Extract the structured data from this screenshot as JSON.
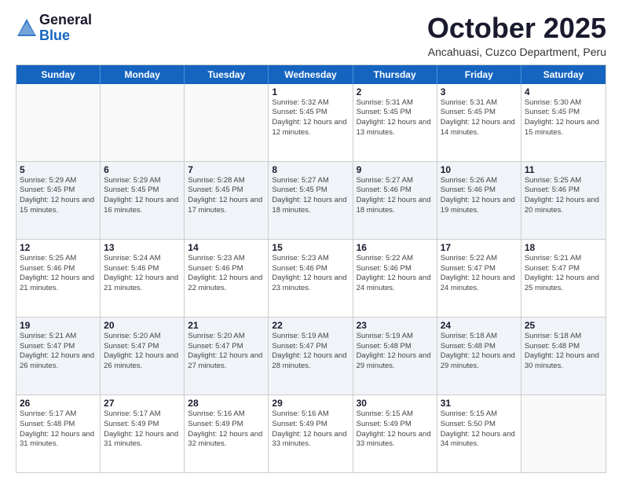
{
  "header": {
    "logo_general": "General",
    "logo_blue": "Blue",
    "month": "October 2025",
    "location": "Ancahuasi, Cuzco Department, Peru"
  },
  "weekdays": [
    "Sunday",
    "Monday",
    "Tuesday",
    "Wednesday",
    "Thursday",
    "Friday",
    "Saturday"
  ],
  "rows": [
    [
      {
        "day": "",
        "sunrise": "",
        "sunset": "",
        "daylight": "",
        "alt": false
      },
      {
        "day": "",
        "sunrise": "",
        "sunset": "",
        "daylight": "",
        "alt": false
      },
      {
        "day": "",
        "sunrise": "",
        "sunset": "",
        "daylight": "",
        "alt": false
      },
      {
        "day": "1",
        "sunrise": "Sunrise: 5:32 AM",
        "sunset": "Sunset: 5:45 PM",
        "daylight": "Daylight: 12 hours and 12 minutes.",
        "alt": false
      },
      {
        "day": "2",
        "sunrise": "Sunrise: 5:31 AM",
        "sunset": "Sunset: 5:45 PM",
        "daylight": "Daylight: 12 hours and 13 minutes.",
        "alt": false
      },
      {
        "day": "3",
        "sunrise": "Sunrise: 5:31 AM",
        "sunset": "Sunset: 5:45 PM",
        "daylight": "Daylight: 12 hours and 14 minutes.",
        "alt": false
      },
      {
        "day": "4",
        "sunrise": "Sunrise: 5:30 AM",
        "sunset": "Sunset: 5:45 PM",
        "daylight": "Daylight: 12 hours and 15 minutes.",
        "alt": false
      }
    ],
    [
      {
        "day": "5",
        "sunrise": "Sunrise: 5:29 AM",
        "sunset": "Sunset: 5:45 PM",
        "daylight": "Daylight: 12 hours and 15 minutes.",
        "alt": true
      },
      {
        "day": "6",
        "sunrise": "Sunrise: 5:29 AM",
        "sunset": "Sunset: 5:45 PM",
        "daylight": "Daylight: 12 hours and 16 minutes.",
        "alt": true
      },
      {
        "day": "7",
        "sunrise": "Sunrise: 5:28 AM",
        "sunset": "Sunset: 5:45 PM",
        "daylight": "Daylight: 12 hours and 17 minutes.",
        "alt": true
      },
      {
        "day": "8",
        "sunrise": "Sunrise: 5:27 AM",
        "sunset": "Sunset: 5:45 PM",
        "daylight": "Daylight: 12 hours and 18 minutes.",
        "alt": true
      },
      {
        "day": "9",
        "sunrise": "Sunrise: 5:27 AM",
        "sunset": "Sunset: 5:46 PM",
        "daylight": "Daylight: 12 hours and 18 minutes.",
        "alt": true
      },
      {
        "day": "10",
        "sunrise": "Sunrise: 5:26 AM",
        "sunset": "Sunset: 5:46 PM",
        "daylight": "Daylight: 12 hours and 19 minutes.",
        "alt": true
      },
      {
        "day": "11",
        "sunrise": "Sunrise: 5:25 AM",
        "sunset": "Sunset: 5:46 PM",
        "daylight": "Daylight: 12 hours and 20 minutes.",
        "alt": true
      }
    ],
    [
      {
        "day": "12",
        "sunrise": "Sunrise: 5:25 AM",
        "sunset": "Sunset: 5:46 PM",
        "daylight": "Daylight: 12 hours and 21 minutes.",
        "alt": false
      },
      {
        "day": "13",
        "sunrise": "Sunrise: 5:24 AM",
        "sunset": "Sunset: 5:46 PM",
        "daylight": "Daylight: 12 hours and 21 minutes.",
        "alt": false
      },
      {
        "day": "14",
        "sunrise": "Sunrise: 5:23 AM",
        "sunset": "Sunset: 5:46 PM",
        "daylight": "Daylight: 12 hours and 22 minutes.",
        "alt": false
      },
      {
        "day": "15",
        "sunrise": "Sunrise: 5:23 AM",
        "sunset": "Sunset: 5:46 PM",
        "daylight": "Daylight: 12 hours and 23 minutes.",
        "alt": false
      },
      {
        "day": "16",
        "sunrise": "Sunrise: 5:22 AM",
        "sunset": "Sunset: 5:46 PM",
        "daylight": "Daylight: 12 hours and 24 minutes.",
        "alt": false
      },
      {
        "day": "17",
        "sunrise": "Sunrise: 5:22 AM",
        "sunset": "Sunset: 5:47 PM",
        "daylight": "Daylight: 12 hours and 24 minutes.",
        "alt": false
      },
      {
        "day": "18",
        "sunrise": "Sunrise: 5:21 AM",
        "sunset": "Sunset: 5:47 PM",
        "daylight": "Daylight: 12 hours and 25 minutes.",
        "alt": false
      }
    ],
    [
      {
        "day": "19",
        "sunrise": "Sunrise: 5:21 AM",
        "sunset": "Sunset: 5:47 PM",
        "daylight": "Daylight: 12 hours and 26 minutes.",
        "alt": true
      },
      {
        "day": "20",
        "sunrise": "Sunrise: 5:20 AM",
        "sunset": "Sunset: 5:47 PM",
        "daylight": "Daylight: 12 hours and 26 minutes.",
        "alt": true
      },
      {
        "day": "21",
        "sunrise": "Sunrise: 5:20 AM",
        "sunset": "Sunset: 5:47 PM",
        "daylight": "Daylight: 12 hours and 27 minutes.",
        "alt": true
      },
      {
        "day": "22",
        "sunrise": "Sunrise: 5:19 AM",
        "sunset": "Sunset: 5:47 PM",
        "daylight": "Daylight: 12 hours and 28 minutes.",
        "alt": true
      },
      {
        "day": "23",
        "sunrise": "Sunrise: 5:19 AM",
        "sunset": "Sunset: 5:48 PM",
        "daylight": "Daylight: 12 hours and 29 minutes.",
        "alt": true
      },
      {
        "day": "24",
        "sunrise": "Sunrise: 5:18 AM",
        "sunset": "Sunset: 5:48 PM",
        "daylight": "Daylight: 12 hours and 29 minutes.",
        "alt": true
      },
      {
        "day": "25",
        "sunrise": "Sunrise: 5:18 AM",
        "sunset": "Sunset: 5:48 PM",
        "daylight": "Daylight: 12 hours and 30 minutes.",
        "alt": true
      }
    ],
    [
      {
        "day": "26",
        "sunrise": "Sunrise: 5:17 AM",
        "sunset": "Sunset: 5:48 PM",
        "daylight": "Daylight: 12 hours and 31 minutes.",
        "alt": false
      },
      {
        "day": "27",
        "sunrise": "Sunrise: 5:17 AM",
        "sunset": "Sunset: 5:49 PM",
        "daylight": "Daylight: 12 hours and 31 minutes.",
        "alt": false
      },
      {
        "day": "28",
        "sunrise": "Sunrise: 5:16 AM",
        "sunset": "Sunset: 5:49 PM",
        "daylight": "Daylight: 12 hours and 32 minutes.",
        "alt": false
      },
      {
        "day": "29",
        "sunrise": "Sunrise: 5:16 AM",
        "sunset": "Sunset: 5:49 PM",
        "daylight": "Daylight: 12 hours and 33 minutes.",
        "alt": false
      },
      {
        "day": "30",
        "sunrise": "Sunrise: 5:15 AM",
        "sunset": "Sunset: 5:49 PM",
        "daylight": "Daylight: 12 hours and 33 minutes.",
        "alt": false
      },
      {
        "day": "31",
        "sunrise": "Sunrise: 5:15 AM",
        "sunset": "Sunset: 5:50 PM",
        "daylight": "Daylight: 12 hours and 34 minutes.",
        "alt": false
      },
      {
        "day": "",
        "sunrise": "",
        "sunset": "",
        "daylight": "",
        "alt": false
      }
    ]
  ]
}
